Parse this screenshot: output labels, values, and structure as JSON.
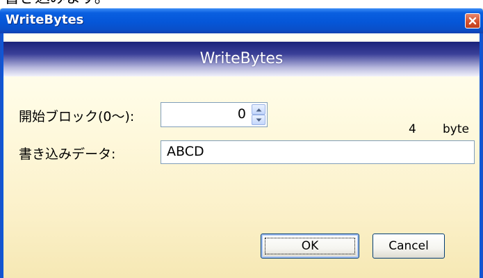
{
  "page": {
    "clipped_caption": "書き込みます。"
  },
  "window": {
    "title": "WriteBytes",
    "close_icon": "close-x-icon",
    "titlebar_color": "#0556d8"
  },
  "dialog": {
    "banner_title": "WriteBytes",
    "start_block": {
      "label": "開始ブロック(0～):",
      "value": "0"
    },
    "byte_count": {
      "value": "4",
      "unit": "byte"
    },
    "write_data": {
      "label": "書き込みデータ:",
      "value": "ABCD"
    },
    "buttons": {
      "ok": "OK",
      "cancel": "Cancel"
    }
  }
}
